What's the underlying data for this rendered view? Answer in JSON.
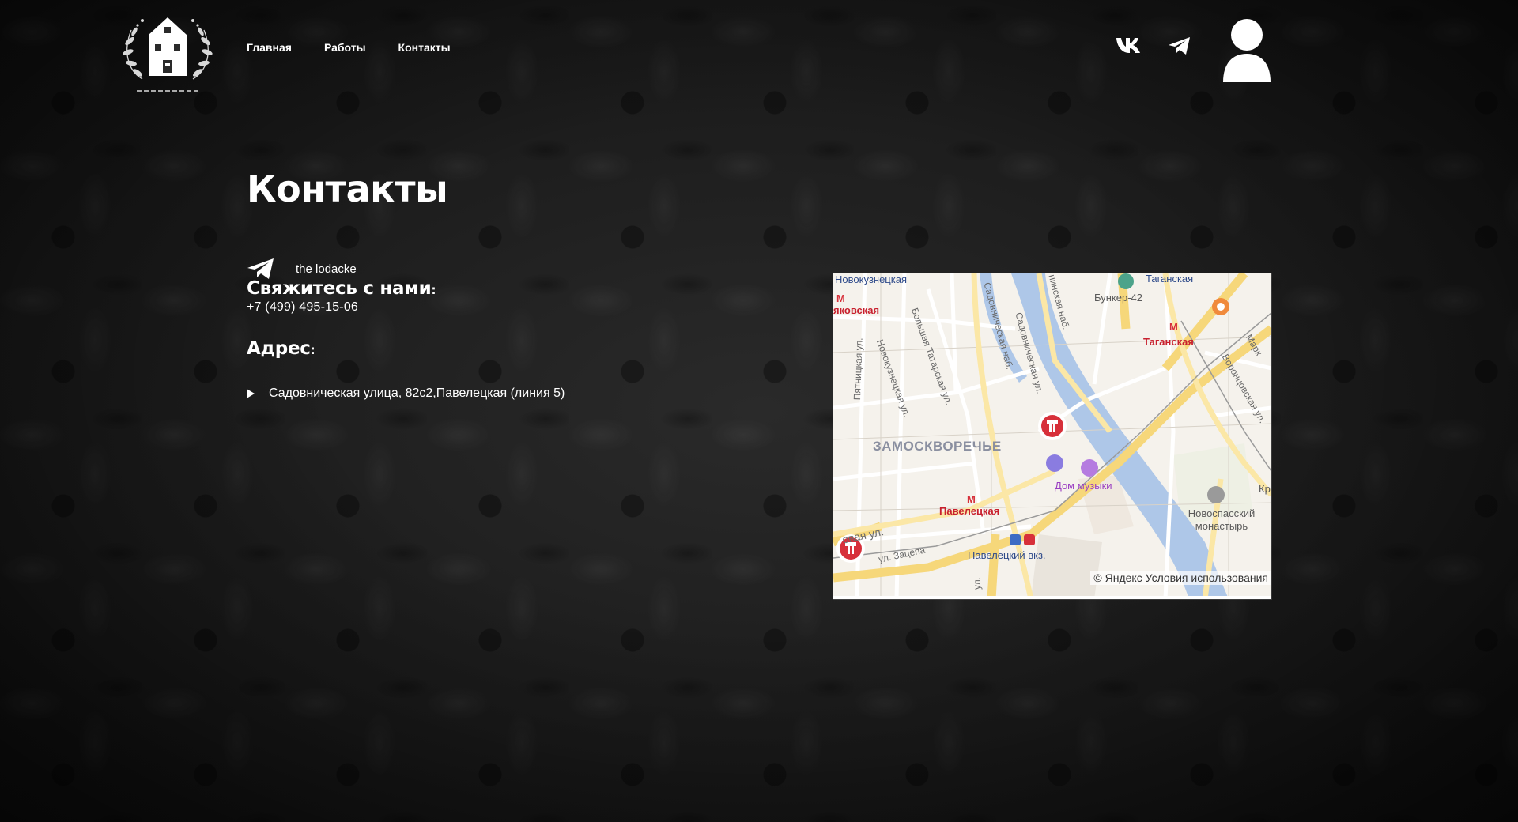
{
  "header": {
    "logo_icon": "house-wreath-logo",
    "nav": [
      {
        "label": "Главная"
      },
      {
        "label": "Работы"
      },
      {
        "label": "Контакты"
      }
    ],
    "social": [
      {
        "icon": "vk-icon"
      },
      {
        "icon": "telegram-icon"
      }
    ],
    "profile_icon": "user-avatar-icon"
  },
  "main": {
    "title": "Контакты",
    "telegram": {
      "icon": "telegram-icon",
      "label": "the lodacke"
    },
    "contact": {
      "heading": "Свяжитесь с нами",
      "colon": ":",
      "phone": "+7 (499) 495-15-06"
    },
    "address": {
      "heading": "Адрес",
      "colon": ":",
      "text": "Садовническая улица, 82с2,Павелецкая (линия 5)"
    }
  },
  "map": {
    "labels": {
      "novokuznetskaya": "Новокузнецкая",
      "tretyakovskaya": "яковская",
      "taganskaya_top": "Таганская",
      "bunker": "Бункер-42",
      "taganskaya": "Таганская",
      "marks": "Марк",
      "vorontsovskaya": "Воронцовская ул.",
      "pyatnitskaya": "Пятницкая ул.",
      "novokuznetskaya_st": "Новокузнецкая ул.",
      "b_tatarskaya": "Большая Татарская ул.",
      "sadovnicheskaya_emb": "Садовническая наб.",
      "sadovnicheskaya_st": "Садовническая ул.",
      "kosmodamianskaya": "нинская наб.",
      "district": "ЗАМОСКВОРЕЧЬЕ",
      "dom_muzyki": "Дом музыки",
      "paveletskaya": "Павелецкая",
      "novospassky": "Новоспасский монастырь",
      "kr": "Кр",
      "valovaya": "овая ул.",
      "zatsepa": "ул. Зацепа",
      "paveletsky_vokzal": "Павелецкий вкз.",
      "ul": "ул."
    },
    "footer": {
      "copyright": "© Яндекс",
      "terms": "Условия использования"
    }
  }
}
